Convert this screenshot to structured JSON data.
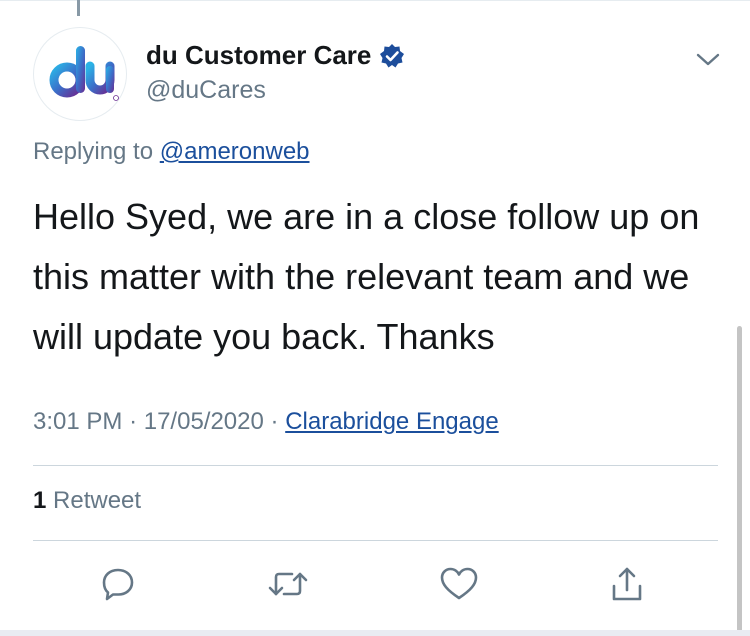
{
  "tweet": {
    "display_name": "du Customer Care",
    "handle": "@duCares",
    "replying_prefix": "Replying to",
    "replying_to": "@ameronweb",
    "text": "Hello Syed, we are in a close follow up on this matter with the relevant team and we will update you back. Thanks",
    "time": "3:01 PM",
    "date": "17/05/2020",
    "separator": "·",
    "source": "Clarabridge Engage",
    "retweet_count": "1",
    "retweet_label": "Retweet"
  },
  "icons": {
    "verified": "verified-badge-icon",
    "menu": "chevron-down-icon",
    "reply": "reply-icon",
    "retweet": "retweet-icon",
    "like": "heart-icon",
    "share": "share-icon"
  },
  "colors": {
    "link": "#1b4f9c",
    "secondary_text": "#657786",
    "verified": "#1d4d9b",
    "brand_gradient_start": "#2bb3e6",
    "brand_gradient_end": "#6a2c91"
  }
}
